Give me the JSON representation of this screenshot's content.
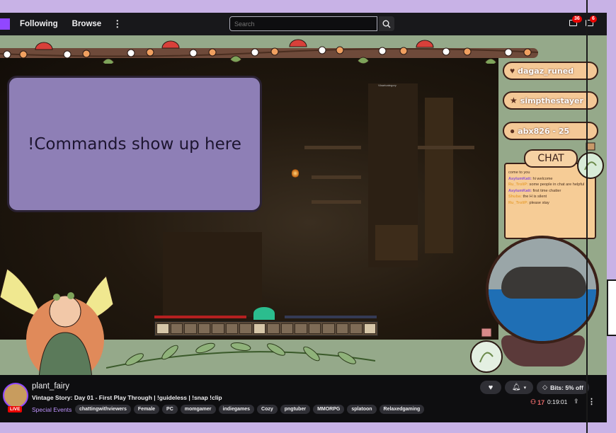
{
  "nav": {
    "following": "Following",
    "browse": "Browse",
    "more": "⋮",
    "search_placeholder": "Search",
    "notifications_count": "36",
    "inbox_count": "6"
  },
  "overlay": {
    "commands_text": "!Commands show up here",
    "event_follow": "dagaz_runed",
    "event_sub": "simpthestayer",
    "event_bits": "abx826 - 25",
    "chat_title": "CHAT",
    "tiny_label": "Vlaartcategory",
    "chat": [
      {
        "user": "",
        "text": "come to you"
      },
      {
        "user": "AsylumKatt:",
        "text": "hi welcome"
      },
      {
        "user": "Ru_TroliP:",
        "text": "some people in chat are helpful"
      },
      {
        "user": "AsylumKatt:",
        "text": "first time chatter"
      },
      {
        "user": "Shuba:",
        "text": "the H is silent"
      },
      {
        "user": "Ru_TroliP:",
        "text": "please stay"
      }
    ]
  },
  "stream_info": {
    "channel": "plant_fairy",
    "live": "LIVE",
    "title": "Vintage Story: Day 01 - First Play Through | !guideless | !snap !clip",
    "category": "Special Events",
    "tags": [
      "chattingwithviewers",
      "Female",
      "PC",
      "momgamer",
      "indiegames",
      "Cozy",
      "pngtuber",
      "MMORPG",
      "splatoon",
      "Relaxedgaming"
    ],
    "bits_label": "Bits: 5% off",
    "viewers": "17",
    "uptime": "0:19:01"
  },
  "colors": {
    "twitch_purple": "#9147ff",
    "live_red": "#eb0400",
    "overlay_green": "#95a98a",
    "command_box": "#8e7fb6"
  }
}
